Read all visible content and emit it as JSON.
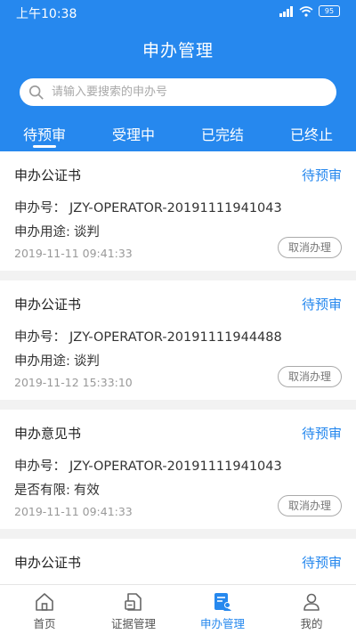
{
  "status_bar": {
    "time": "上午10:38",
    "battery": "95"
  },
  "header": {
    "title": "申办管理"
  },
  "search": {
    "placeholder": "请输入要搜索的申办号"
  },
  "tabs": [
    {
      "label": "待预审",
      "active": true
    },
    {
      "label": "受理中",
      "active": false
    },
    {
      "label": "已完结",
      "active": false
    },
    {
      "label": "已终止",
      "active": false
    }
  ],
  "cards": [
    {
      "title": "申办公证书",
      "status": "待预审",
      "line1_label": "申办号：",
      "line1_value": "JZY-OPERATOR-20191111941043",
      "line2_label": "申办用途:",
      "line2_value": "谈判",
      "date": "2019-11-11 09:41:33",
      "cancel": "取消办理"
    },
    {
      "title": "申办公证书",
      "status": "待预审",
      "line1_label": "申办号：",
      "line1_value": "JZY-OPERATOR-20191111944488",
      "line2_label": "申办用途:",
      "line2_value": "谈判",
      "date": "2019-11-12 15:33:10",
      "cancel": "取消办理"
    },
    {
      "title": "申办意见书",
      "status": "待预审",
      "line1_label": "申办号：",
      "line1_value": "JZY-OPERATOR-20191111941043",
      "line2_label": "是否有限:",
      "line2_value": "有效",
      "date": "2019-11-11 09:41:33",
      "cancel": "取消办理"
    },
    {
      "title": "申办公证书",
      "status": "待预审",
      "line1_label": "",
      "line1_value": "",
      "line2_label": "",
      "line2_value": "",
      "date": "",
      "cancel": ""
    }
  ],
  "bottom_nav": [
    {
      "label": "首页",
      "icon": "home-icon",
      "active": false
    },
    {
      "label": "证据管理",
      "icon": "evidence-icon",
      "active": false
    },
    {
      "label": "申办管理",
      "icon": "application-icon",
      "active": true
    },
    {
      "label": "我的",
      "icon": "user-icon",
      "active": false
    }
  ],
  "colors": {
    "primary": "#2688ee",
    "background": "#f2f2f2"
  }
}
